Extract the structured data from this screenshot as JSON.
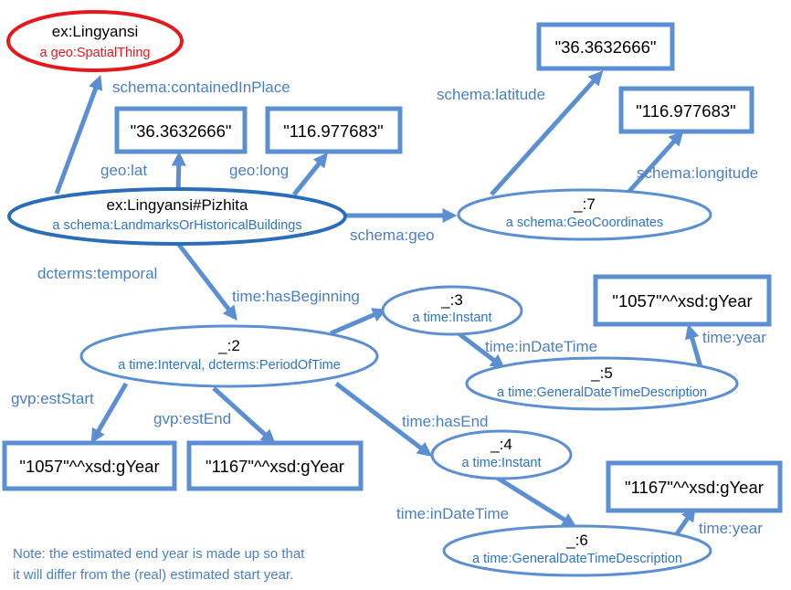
{
  "nodes": {
    "lingyansi": {
      "name": "ex:Lingyansi",
      "type": "a geo:SpatialThing"
    },
    "pizhita": {
      "name": "ex:Lingyansi#Pizhita",
      "type": "a schema:LandmarksOrHistoricalBuildings"
    },
    "n7": {
      "name": "_:7",
      "type": "a schema:GeoCoordinates"
    },
    "n2": {
      "name": "_:2",
      "type": "a time:Interval, dcterms:PeriodOfTime"
    },
    "n3": {
      "name": "_:3",
      "type": "a time:Instant"
    },
    "n5": {
      "name": "_:5",
      "type": "a time:GeneralDateTimeDescription"
    },
    "n4": {
      "name": "_:4",
      "type": "a time:Instant"
    },
    "n6": {
      "name": "_:6",
      "type": "a time:GeneralDateTimeDescription"
    }
  },
  "literals": {
    "geo_lat": "\"36.3632666\"",
    "geo_long": "\"116.977683\"",
    "schema_lat": "\"36.3632666\"",
    "schema_long": "\"116.977683\"",
    "est_start": "\"1057\"^^xsd:gYear",
    "est_end": "\"1167\"^^xsd:gYear",
    "year5": "\"1057\"^^xsd:gYear",
    "year6": "\"1167\"^^xsd:gYear"
  },
  "edges": {
    "contained_in_place": "schema:containedInPlace",
    "geo_lat": "geo:lat",
    "geo_long": "geo:long",
    "schema_geo": "schema:geo",
    "schema_latitude": "schema:latitude",
    "schema_longitude": "schema:longitude",
    "dcterms_temporal": "dcterms:temporal",
    "has_beginning": "time:hasBeginning",
    "in_date_time_3": "time:inDateTime",
    "year_5": "time:year",
    "has_end": "time:hasEnd",
    "in_date_time_4": "time:inDateTime",
    "year_6": "time:year",
    "est_start": "gvp:estStart",
    "est_end": "gvp:estEnd"
  },
  "note": {
    "line1": "Note: the estimated end year is made up so that",
    "line2": "it will differ from the (real) estimated start year."
  },
  "colors": {
    "edge": "#5b8fd1",
    "main_node": "#2a6db8",
    "spatial_thing": "#e3191c",
    "type_text": "#2e74c4"
  }
}
